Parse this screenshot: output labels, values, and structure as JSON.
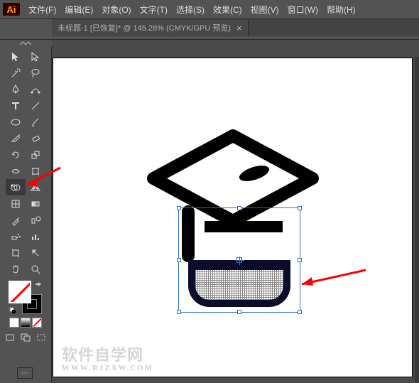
{
  "app": {
    "logo": "Ai"
  },
  "menu": {
    "file": "文件(F)",
    "edit": "编辑(E)",
    "object": "对象(O)",
    "type": "文字(T)",
    "select": "选择(S)",
    "effect": "效果(C)",
    "view": "视图(V)",
    "window": "窗口(W)",
    "help": "帮助(H)"
  },
  "document": {
    "tab_title": "未标题-1 [已恢复]* @ 145.28% (CMYK/GPU 预览)",
    "close": "×"
  },
  "tools": {
    "selection": "selection-tool",
    "direct": "direct-selection-tool",
    "magicwand": "magic-wand-tool",
    "lasso": "lasso-tool",
    "pen": "pen-tool",
    "curvature": "curvature-tool",
    "type": "type-tool",
    "line": "line-segment-tool",
    "rectangle": "rectangle-tool",
    "paintbrush": "paintbrush-tool",
    "shaper": "shaper-tool",
    "eraser": "eraser-tool",
    "rotate": "rotate-tool",
    "scale": "scale-tool",
    "width": "width-tool",
    "freetrans": "free-transform-tool",
    "shapebuilder": "shape-builder-tool",
    "perspective": "perspective-grid-tool",
    "mesh": "mesh-tool",
    "gradient": "gradient-tool",
    "eyedropper": "eyedropper-tool",
    "blend": "blend-tool",
    "symbolspray": "symbol-sprayer-tool",
    "columngraph": "column-graph-tool",
    "artboard": "artboard-tool",
    "slice": "slice-tool",
    "hand": "hand-tool",
    "zoom": "zoom-tool"
  },
  "watermark": {
    "main": "软件自学网",
    "sub": "WWW.RJZXW.COM"
  },
  "expand_stub": "⋯"
}
